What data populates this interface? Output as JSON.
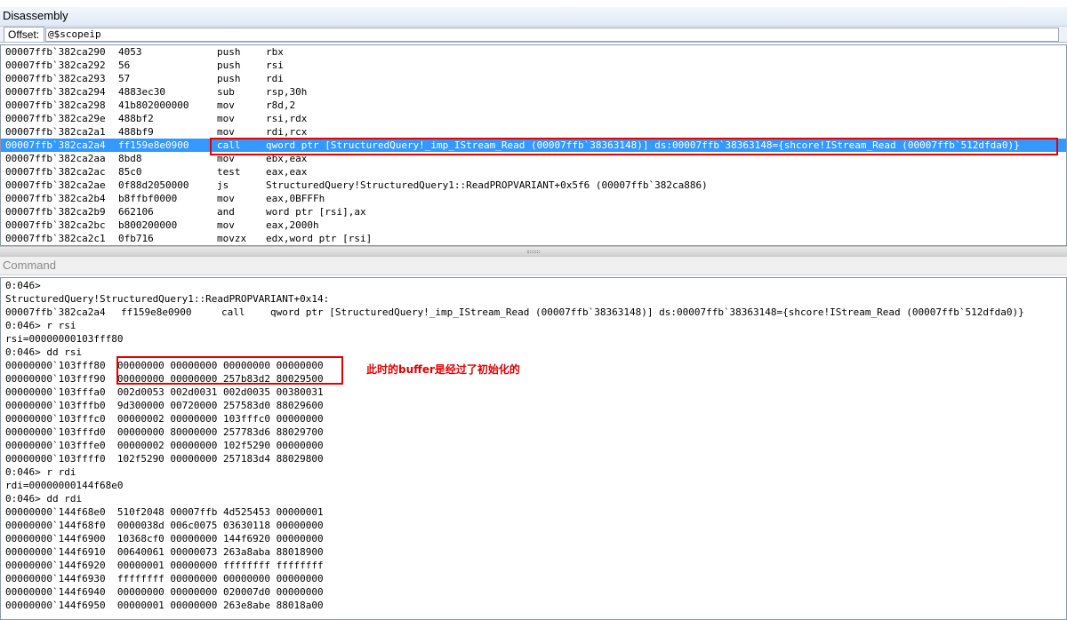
{
  "disassembly": {
    "title": "Disassembly",
    "offset_label": "Offset:",
    "offset_value": "@$scopeip",
    "lines": [
      {
        "addr": "00007ffb`382ca290",
        "bytes": "4053",
        "mnem": "push",
        "ops": "rbx"
      },
      {
        "addr": "00007ffb`382ca292",
        "bytes": "56",
        "mnem": "push",
        "ops": "rsi"
      },
      {
        "addr": "00007ffb`382ca293",
        "bytes": "57",
        "mnem": "push",
        "ops": "rdi"
      },
      {
        "addr": "00007ffb`382ca294",
        "bytes": "4883ec30",
        "mnem": "sub",
        "ops": "rsp,30h"
      },
      {
        "addr": "00007ffb`382ca298",
        "bytes": "41b802000000",
        "mnem": "mov",
        "ops": "r8d,2"
      },
      {
        "addr": "00007ffb`382ca29e",
        "bytes": "488bf2",
        "mnem": "mov",
        "ops": "rsi,rdx"
      },
      {
        "addr": "00007ffb`382ca2a1",
        "bytes": "488bf9",
        "mnem": "mov",
        "ops": "rdi,rcx"
      },
      {
        "addr": "00007ffb`382ca2a4",
        "bytes": "ff159e8e0900",
        "mnem": "call",
        "ops": "qword ptr [StructuredQuery!_imp_IStream_Read (00007ffb`38363148)] ds:00007ffb`38363148={shcore!IStream_Read (00007ffb`512dfda0)}"
      },
      {
        "addr": "00007ffb`382ca2aa",
        "bytes": "8bd8",
        "mnem": "mov",
        "ops": "ebx,eax"
      },
      {
        "addr": "00007ffb`382ca2ac",
        "bytes": "85c0",
        "mnem": "test",
        "ops": "eax,eax"
      },
      {
        "addr": "00007ffb`382ca2ae",
        "bytes": "0f88d2050000",
        "mnem": "js",
        "ops": "StructuredQuery!StructuredQuery1::ReadPROPVARIANT+0x5f6 (00007ffb`382ca886)"
      },
      {
        "addr": "00007ffb`382ca2b4",
        "bytes": "b8ffbf0000",
        "mnem": "mov",
        "ops": "eax,0BFFFh"
      },
      {
        "addr": "00007ffb`382ca2b9",
        "bytes": "662106",
        "mnem": "and",
        "ops": "word ptr [rsi],ax"
      },
      {
        "addr": "00007ffb`382ca2bc",
        "bytes": "b800200000",
        "mnem": "mov",
        "ops": "eax,2000h"
      },
      {
        "addr": "00007ffb`382ca2c1",
        "bytes": "0fb716",
        "mnem": "movzx",
        "ops": "edx,word ptr [rsi]"
      }
    ]
  },
  "command": {
    "title": "Command",
    "header_lines": [
      "0:046>",
      "StructuredQuery!StructuredQuery1::ReadPROPVARIANT+0x14:"
    ],
    "call_line": {
      "addr": "00007ffb`382ca2a4",
      "bytes": "ff159e8e0900",
      "mnem": "call",
      "ops": "qword ptr [StructuredQuery!_imp_IStream_Read (00007ffb`38363148)] ds:00007ffb`38363148={shcore!IStream_Read (00007ffb`512dfda0)}"
    },
    "lines": [
      "0:046> r rsi",
      "rsi=00000000103fff80",
      "0:046> dd rsi",
      "00000000`103fff80  00000000 00000000 00000000 00000000",
      "00000000`103fff90  00000000 00000000 257b83d2 80029500",
      "00000000`103fffa0  002d0053 002d0031 002d0035 00380031",
      "00000000`103fffb0  9d300000 00720000 257583d0 88029600",
      "00000000`103fffc0  00000002 00000000 103fffc0 00000000",
      "00000000`103fffd0  00000000 80000000 257783d6 88029700",
      "00000000`103fffe0  00000002 00000000 102f5290 00000000",
      "00000000`103ffff0  102f5290 00000000 257183d4 88029800",
      "0:046> r rdi",
      "rdi=00000000144f68e0",
      "0:046> dd rdi",
      "00000000`144f68e0  510f2048 00007ffb 4d525453 00000001",
      "00000000`144f68f0  0000038d 006c0075 03630118 00000000",
      "00000000`144f6900  10368cf0 00000000 144f6920 00000000",
      "00000000`144f6910  00640061 00000073 263a8aba 88018900",
      "00000000`144f6920  00000001 00000000 ffffffff ffffffff",
      "00000000`144f6930  ffffffff 00000000 00000000 00000000",
      "00000000`144f6940  00000000 00000000 020007d0 00000000",
      "00000000`144f6950  00000001 00000000 263e8abe 88018a00"
    ],
    "annotation": "此时的buffer是经过了初始化的"
  },
  "colors": {
    "selection": "#3399ff",
    "highlight_box": "#e60000"
  }
}
